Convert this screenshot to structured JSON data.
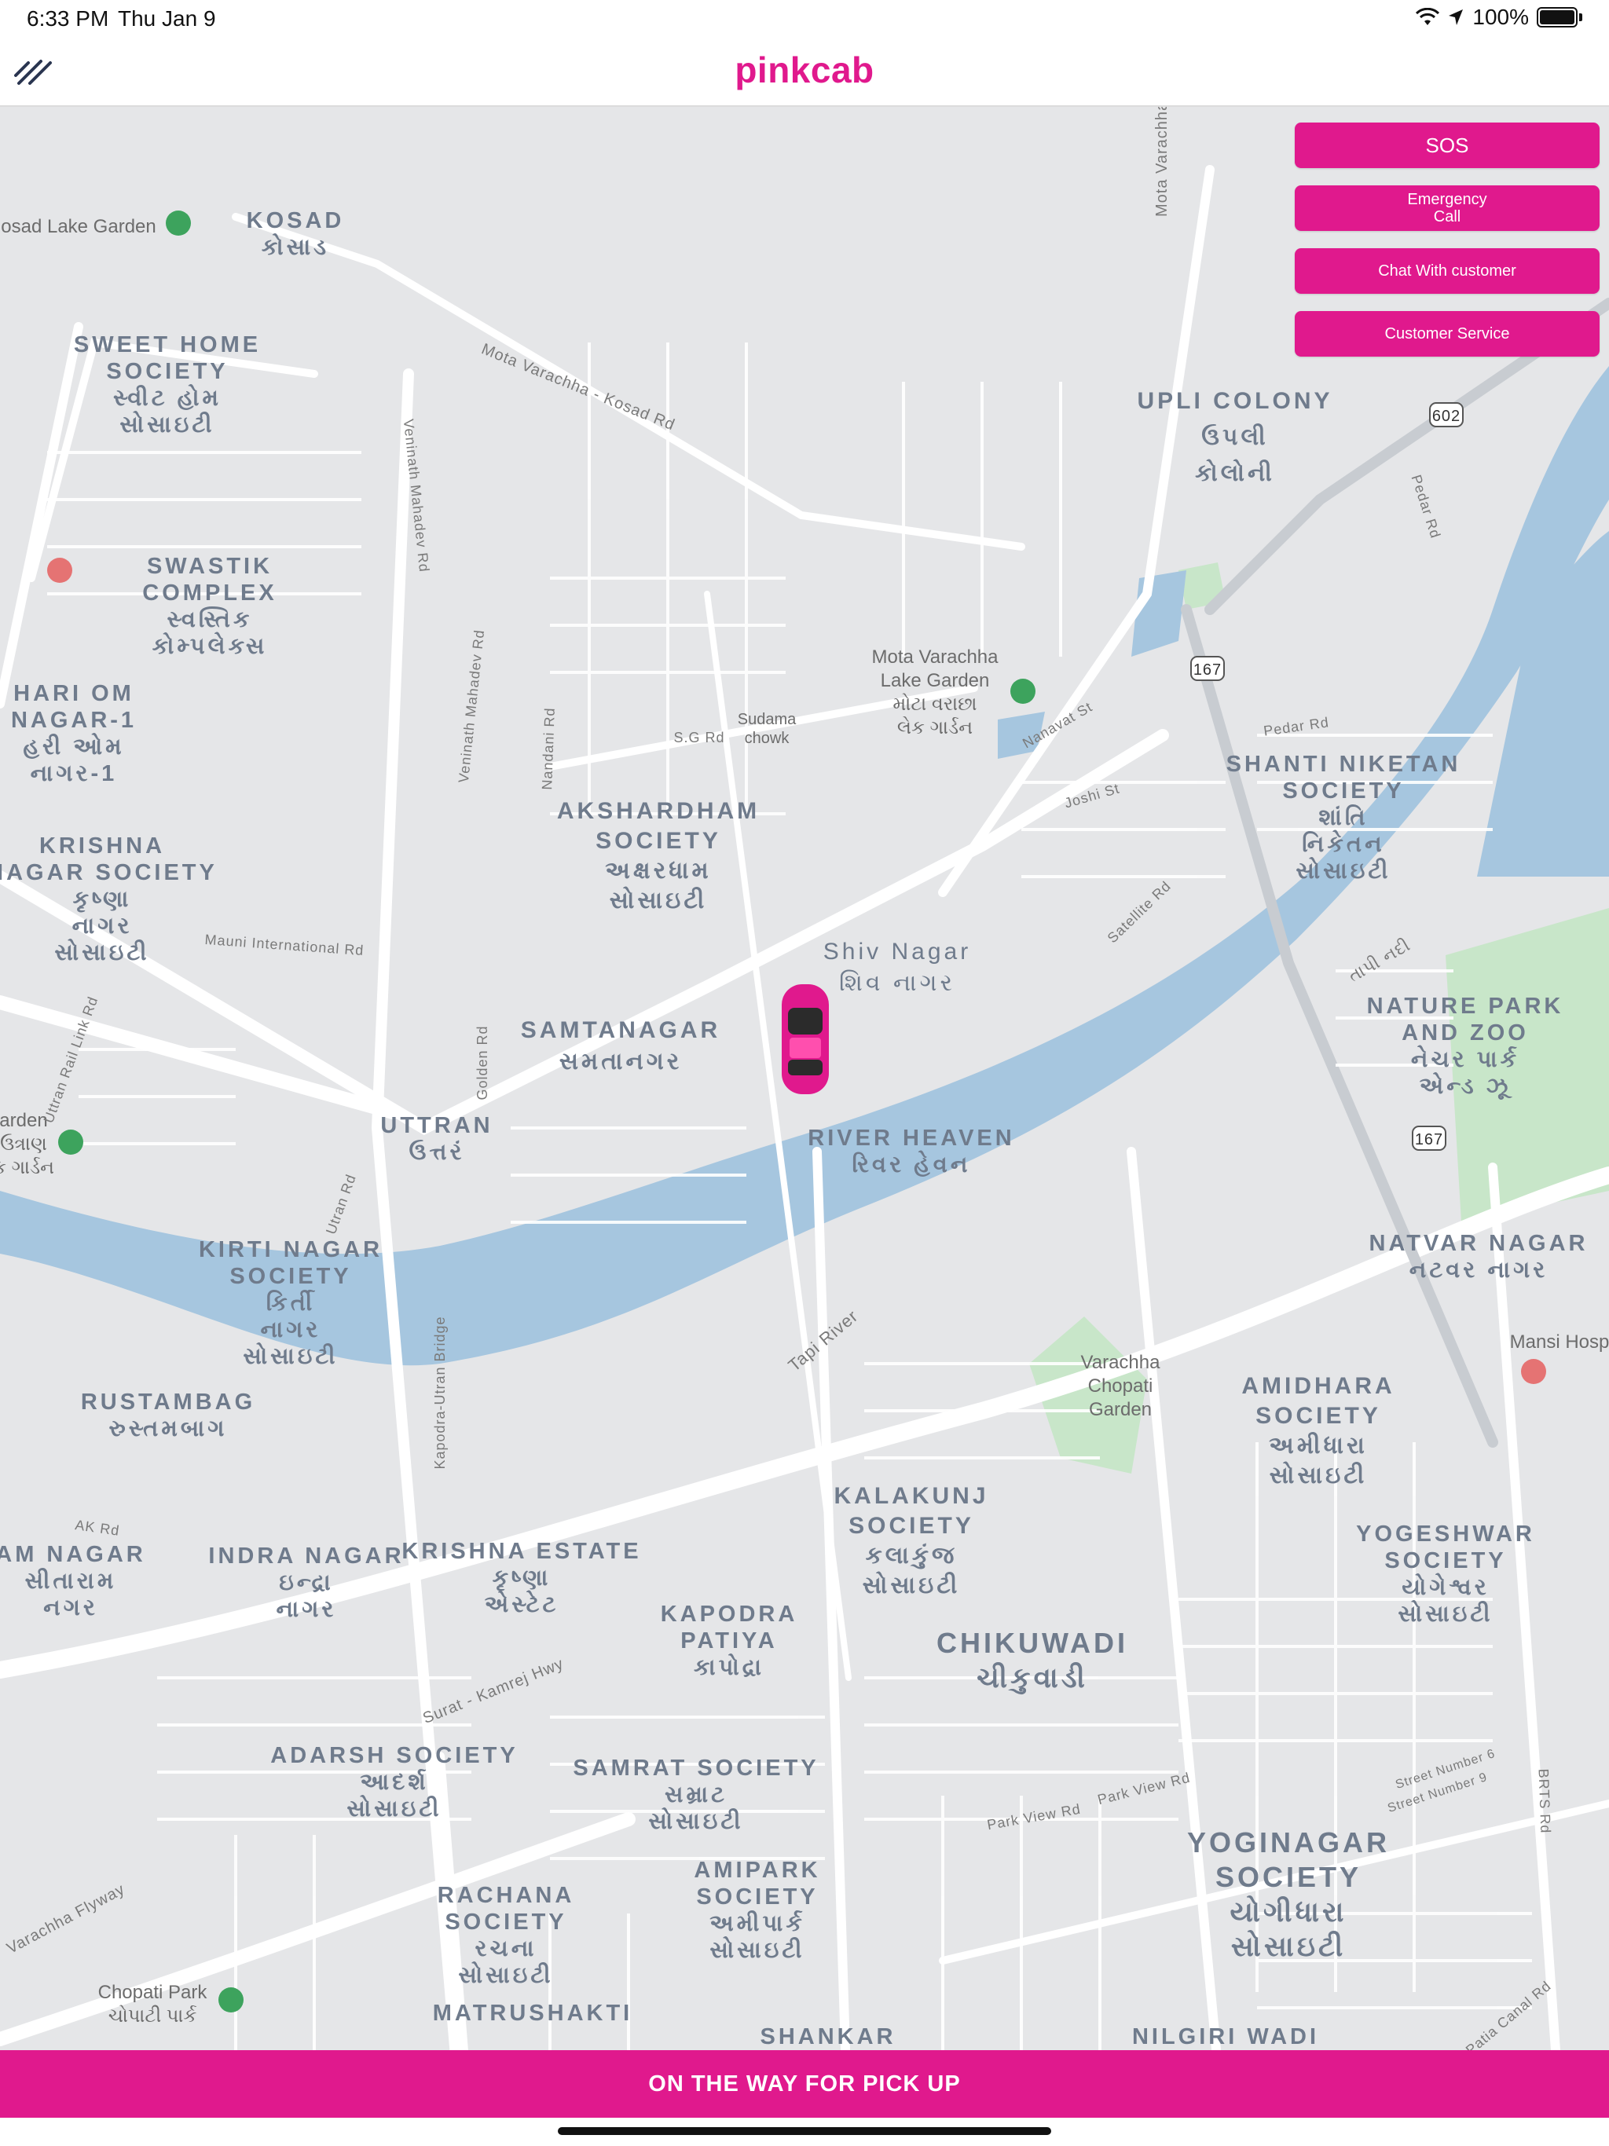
{
  "status_bar": {
    "time": "6:33 PM",
    "date": "Thu Jan 9",
    "battery": "100%"
  },
  "header": {
    "brand": "pinkcab",
    "menu_icon": "menu-icon"
  },
  "actions": {
    "sos": "SOS",
    "emergency_call_line1": "Emergency",
    "emergency_call_line2": "Call",
    "chat": "Chat With customer",
    "customer_service": "Customer Service"
  },
  "map": {
    "areas": [
      {
        "line1": "KOSAD",
        "line2": "કોસાડ"
      },
      {
        "line1": "SWEET HOME",
        "line2": "SOCIETY",
        "line3": "સ્વીટ હોમ",
        "line4": "સોસાઇટી"
      },
      {
        "line1": "SWASTIK",
        "line2": "COMPLEX",
        "line3": "સ્વસ્તિક",
        "line4": "કોમ્પલેક્સ"
      },
      {
        "line1": "HARI OM",
        "line2": "NAGAR-1",
        "line3": "હરી ઓમ",
        "line4": "નાગર-1"
      },
      {
        "line1": "KRISHNA",
        "line2": "NAGAR SOCIETY",
        "line3": "કૃષ્ણા",
        "line4": "નાગર",
        "line5": "સોસાઇટી"
      },
      {
        "line1": "UPLI COLONY",
        "line2": "ઉપલી",
        "line3": "કોલોની"
      },
      {
        "line1": "AKSHARDHAM",
        "line2": "SOCIETY",
        "line3": "અક્ષરધામ",
        "line4": "સોસાઇટી"
      },
      {
        "line1": "SHANTI NIKETAN",
        "line2": "SOCIETY",
        "line3": "શાંતિ",
        "line4": "નિકેતન",
        "line5": "સોસાઇટી"
      },
      {
        "line1": "Shiv Nagar",
        "line2": "શિવ નાગર"
      },
      {
        "line1": "SAMTANAGAR",
        "line2": "સમતાનગર"
      },
      {
        "line1": "UTTRAN",
        "line2": "ઉત્તરં"
      },
      {
        "line1": "RIVER HEAVEN",
        "line2": "રિવર હેવન"
      },
      {
        "line1": "NATURE PARK",
        "line2": "AND ZOO",
        "line3": "નેચર પાર્ક",
        "line4": "એન્ડ ઝૂ"
      },
      {
        "line1": "KIRTI NAGAR",
        "line2": "SOCIETY",
        "line3": "કિર્તી",
        "line4": "નાગર",
        "line5": "સોસાઇટી"
      },
      {
        "line1": "NATVAR NAGAR",
        "line2": "નટવર નાગર"
      },
      {
        "line1": "RUSTAMBAG",
        "line2": "રુસ્તમબાગ"
      },
      {
        "line1": "AMIDHARA",
        "line2": "SOCIETY",
        "line3": "અમીધારા",
        "line4": "સોસાઇટી"
      },
      {
        "line1": "KALAKUNJ",
        "line2": "SOCIETY",
        "line3": "કલાકુંજ",
        "line4": "સોસાઇટી"
      },
      {
        "line1": "YOGESHWAR",
        "line2": "SOCIETY",
        "line3": "યોગેશ્વર",
        "line4": "સોસાઇટી"
      },
      {
        "line1": "AM NAGAR",
        "line2": "સીતારામ",
        "line3": "નગર"
      },
      {
        "line1": "INDRA NAGAR",
        "line2": "ઇન્દ્રા",
        "line3": "નાગર"
      },
      {
        "line1": "KRISHNA ESTATE",
        "line2": "કૃષ્ણા",
        "line3": "એસ્ટેટ"
      },
      {
        "line1": "KAPODRA",
        "line2": "PATIYA",
        "line3": "કાપોદ્રા"
      },
      {
        "line1": "CHIKUWADI",
        "line2": "ચીકુવાડી"
      },
      {
        "line1": "ADARSH SOCIETY",
        "line2": "આદર્શ",
        "line3": "સોસાઇટી"
      },
      {
        "line1": "SAMRAT SOCIETY",
        "line2": "સમ્રાટ",
        "line3": "સોસાઇટી"
      },
      {
        "line1": "YOGINAGAR",
        "line2": "SOCIETY",
        "line3": "યોગીધારા",
        "line4": "સોસાઇટી"
      },
      {
        "line1": "AMIPARK",
        "line2": "SOCIETY",
        "line3": "અમીપાર્ક",
        "line4": "સોસાઇટી"
      },
      {
        "line1": "RACHANA",
        "line2": "SOCIETY",
        "line3": "રચના",
        "line4": "સોસાઇટી"
      },
      {
        "line1": "MATRUSHAKTI"
      },
      {
        "line1": "SHANKAR"
      },
      {
        "line1": "NILGIRI WADI"
      }
    ],
    "pois": [
      {
        "line1": "osad Lake Garden"
      },
      {
        "line1": "Mota Varachha",
        "line2": "Lake Garden",
        "line3": "મોટા વરાછા",
        "line4": "લેક ગાર્ડન"
      },
      {
        "line1": "Sudama",
        "line2": "chowk"
      },
      {
        "line1": "arden",
        "line2": "ઉત્રાણ",
        "line3": "ક ગાર્ડન"
      },
      {
        "line1": "Varachha",
        "line2": "Chopati",
        "line3": "Garden"
      },
      {
        "line1": "Mansi Hosp"
      },
      {
        "line1": "Chopati Park",
        "line2": "ચોપાટી પાર્ક"
      }
    ],
    "roads": [
      "Mota Varachha - Go",
      "Mota Varachha - Kosad Rd",
      "Veninath Mahadev Rd",
      "Veninath Mahadev Rd",
      "Nandani Rd",
      "S.G Rd",
      "Nanavat St",
      "Pedar Rd",
      "Pedar Rd",
      "Joshi St",
      "Satellite Rd",
      "Mauni International Rd",
      "Golden Rd",
      "Uttran Rail Link Rd",
      "Utran Rd",
      "Tapi River",
      "તાપી નદી",
      "Kapodra-Utran Bridge",
      "AK Rd",
      "Surat - Kamrej Hwy",
      "Varachha Flyway",
      "Park View Rd",
      "Park View Rd",
      "Street Number 6",
      "Street Number 9",
      "BRTS Rd",
      "Patia Canal Rd"
    ],
    "shields": [
      "602",
      "167",
      "167"
    ]
  },
  "trip_status": "ON THE WAY FOR PICK UP",
  "colors": {
    "accent": "#e0198d",
    "water": "#a6c6df",
    "park": "#c8e6c9",
    "land": "#e5e6e8"
  }
}
